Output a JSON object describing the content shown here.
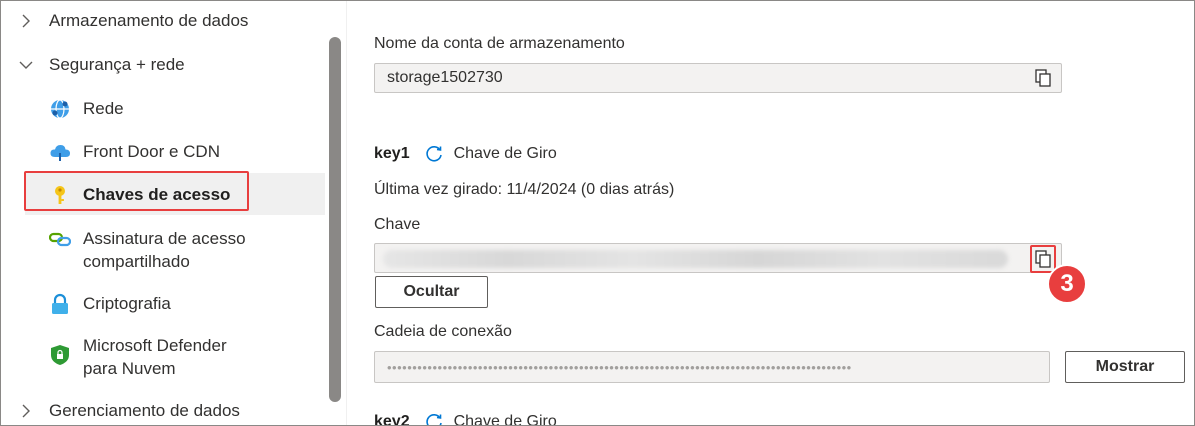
{
  "sidebar": {
    "groups": [
      {
        "label": "Armazenamento de dados"
      },
      {
        "label": "Segurança + rede"
      },
      {
        "label": "Gerenciamento de dados"
      }
    ],
    "items": [
      {
        "label": "Rede",
        "icon": "network-globe-icon"
      },
      {
        "label": "Front Door e CDN",
        "icon": "cloud-cdn-icon"
      },
      {
        "label": "Chaves de acesso",
        "icon": "key-icon"
      },
      {
        "label": "Assinatura de acesso compartilhado",
        "icon": "link-chain-icon"
      },
      {
        "label": "Criptografia",
        "icon": "lock-icon"
      },
      {
        "label": "Microsoft Defender para Nuvem",
        "icon": "shield-icon"
      }
    ]
  },
  "main": {
    "account_label": "Nome da conta de armazenamento",
    "account_value": "storage1502730",
    "key1": {
      "name": "key1",
      "rotate_label": "Chave de Giro",
      "last_rotated": "Última vez girado: 11/4/2024 (0 dias atrás)",
      "key_label": "Chave",
      "hide_button": "Ocultar",
      "connection_label": "Cadeia de conexão",
      "connection_masked": "••••••••••••••••••••••••••••••••••••••••••••••••••••••••••••••••••••••••••••••••••••••••••••",
      "show_button": "Mostrar"
    },
    "key2": {
      "name": "key2",
      "rotate_label": "Chave de Giro"
    }
  },
  "annotation": {
    "step_number": "3",
    "color": "#e83e3e"
  },
  "colors": {
    "accent": "#0078d4",
    "highlight": "#e83e3e",
    "scrollbar": "#8a8886"
  }
}
